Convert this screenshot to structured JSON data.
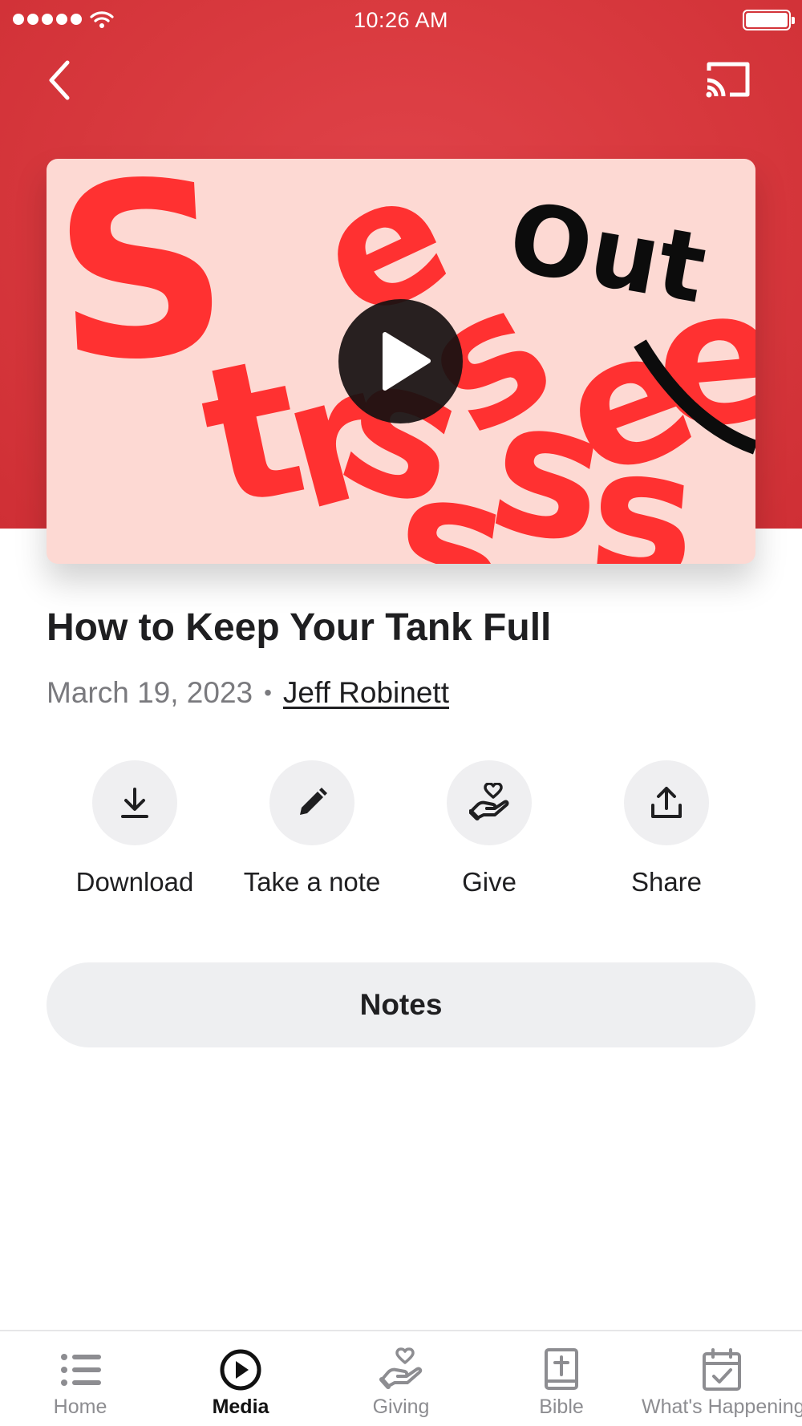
{
  "status_bar": {
    "time": "10:26 AM"
  },
  "header": {
    "back_icon": "chevron-left-icon",
    "cast_icon": "cast-icon"
  },
  "artwork": {
    "words": [
      "Stressed",
      "Out"
    ],
    "play_icon": "play-icon",
    "colors": {
      "background": "#fdd9d3",
      "red": "#ff3131",
      "black": "#0c0c0c"
    }
  },
  "sermon": {
    "title": "How to Keep Your Tank Full",
    "date": "March 19, 2023",
    "separator": "•",
    "speaker": "Jeff Robinett"
  },
  "actions": [
    {
      "label": "Download",
      "icon": "download-icon"
    },
    {
      "label": "Take a note",
      "icon": "pencil-icon"
    },
    {
      "label": "Give",
      "icon": "giving-hand-heart-icon"
    },
    {
      "label": "Share",
      "icon": "share-icon"
    }
  ],
  "notes_button": {
    "label": "Notes"
  },
  "tabbar": {
    "active": "Media",
    "tabs": [
      {
        "label": "Home",
        "icon": "list-icon"
      },
      {
        "label": "Media",
        "icon": "play-circle-icon"
      },
      {
        "label": "Giving",
        "icon": "giving-hand-heart-icon"
      },
      {
        "label": "Bible",
        "icon": "bible-icon"
      },
      {
        "label": "What's Happening",
        "icon": "calendar-check-icon"
      }
    ]
  },
  "colors": {
    "header_red": "#d93a3f",
    "text": "#1f1f21",
    "muted": "#7a7a7e",
    "chip": "#efeff1",
    "tab_inactive": "#8d8d91"
  }
}
